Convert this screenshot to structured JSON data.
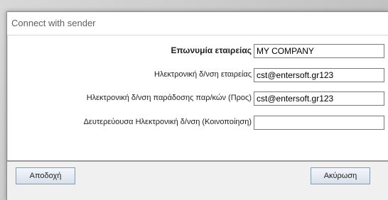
{
  "window": {
    "title": "Connect with sender"
  },
  "form": {
    "rows": [
      {
        "label": "Επωνυμία εταιρείας",
        "value": "MY COMPANY"
      },
      {
        "label": "Ηλεκτρονική δ/νση εταιρείας",
        "value": "cst@entersoft.gr123"
      },
      {
        "label": "Ηλεκτρονική δ/νση παράδοσης παρ/κών (Προς)",
        "value": "cst@entersoft.gr123"
      },
      {
        "label": "Δευτερεύουσα Ηλεκτρονική δ/νση (Κοινοποίηση)",
        "value": ""
      }
    ]
  },
  "buttons": {
    "accept_label": "Αποδοχή",
    "cancel_label": "Ακύρωση"
  }
}
